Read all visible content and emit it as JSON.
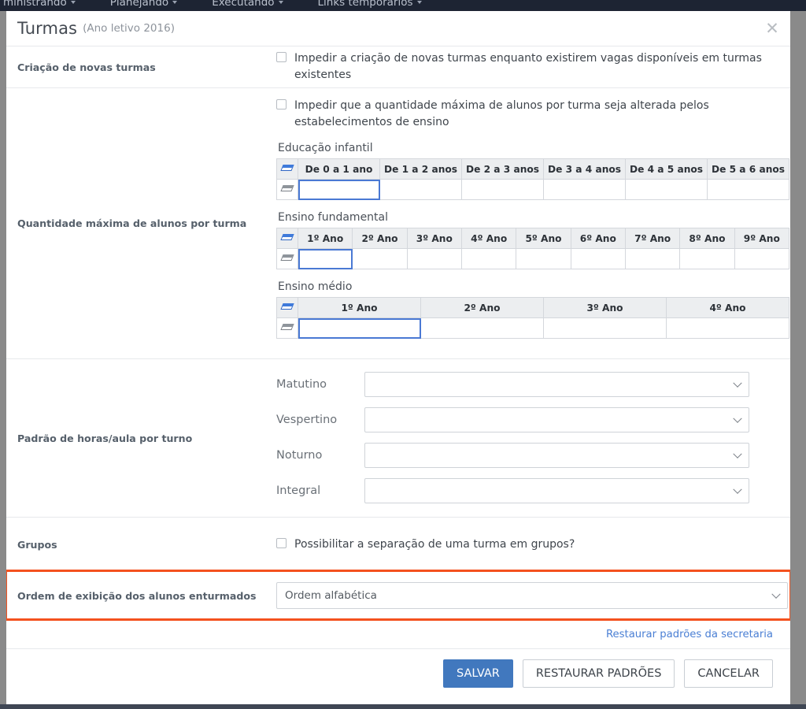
{
  "topnav": {
    "items": [
      {
        "label": "ministrando",
        "icon": "chevron-down-icon"
      },
      {
        "label": "Planejando",
        "icon": "chevron-down-icon"
      },
      {
        "label": "Executando",
        "icon": "chevron-down-icon"
      },
      {
        "label": "Links temporários",
        "icon": "chevron-down-icon"
      }
    ]
  },
  "modal": {
    "title": "Turmas",
    "subtitle": "(Ano letivo 2016)",
    "close_icon": "close-icon"
  },
  "sections": {
    "creation": {
      "label": "Criação de novas turmas",
      "checkbox_label": "Impedir a criação de novas turmas enquanto existirem vagas disponíveis em turmas existentes",
      "checked": false
    },
    "max_students": {
      "label": "Quantidade máxima de alunos por turma",
      "checkbox_label": "Impedir que a quantidade máxima de alunos por turma seja alterada pelos estabelecimentos de ensino",
      "checked": false,
      "tables": [
        {
          "title": "Educação infantil",
          "corner_icon": "eraser-icon",
          "columns": [
            "De 0 a 1 ano",
            "De 1 a 2 anos",
            "De 2 a 3 anos",
            "De 3 a 4 anos",
            "De 4 a 5 anos",
            "De 5 a 6 anos"
          ],
          "values": [
            "",
            "",
            "",
            "",
            "",
            ""
          ],
          "selected_index": 0,
          "equal_widths": true
        },
        {
          "title": "Ensino fundamental",
          "corner_icon": "eraser-icon",
          "columns": [
            "1º Ano",
            "2º Ano",
            "3º Ano",
            "4º Ano",
            "5º Ano",
            "6º Ano",
            "7º Ano",
            "8º Ano",
            "9º Ano"
          ],
          "values": [
            "",
            "",
            "",
            "",
            "",
            "",
            "",
            "",
            ""
          ],
          "selected_index": 0,
          "equal_widths": true
        },
        {
          "title": "Ensino médio",
          "corner_icon": "eraser-icon",
          "columns": [
            "1º Ano",
            "2º Ano",
            "3º Ano",
            "4º Ano"
          ],
          "values": [
            "",
            "",
            "",
            ""
          ],
          "selected_index": 0,
          "equal_widths": true
        }
      ]
    },
    "shifts": {
      "label": "Padrão de horas/aula por turno",
      "rows": [
        {
          "label": "Matutino",
          "value": "",
          "icon": "chevron-down-icon"
        },
        {
          "label": "Vespertino",
          "value": "",
          "icon": "chevron-down-icon"
        },
        {
          "label": "Noturno",
          "value": "",
          "icon": "chevron-down-icon"
        },
        {
          "label": "Integral",
          "value": "",
          "icon": "chevron-down-icon"
        }
      ]
    },
    "groups": {
      "label": "Grupos",
      "checkbox_label": "Possibilitar a separação de uma turma em grupos?",
      "checked": false
    },
    "display_order": {
      "label": "Ordem de exibição dos alunos enturmados",
      "value": "Ordem alfabética",
      "icon": "chevron-down-icon",
      "highlight_color": "#f4511e"
    }
  },
  "footer": {
    "restore_link": "Restaurar padrões da secretaria",
    "save_label": "SALVAR",
    "restore_defaults_label": "RESTAURAR PADRÕES",
    "cancel_label": "CANCELAR",
    "primary_color": "#4178be"
  }
}
